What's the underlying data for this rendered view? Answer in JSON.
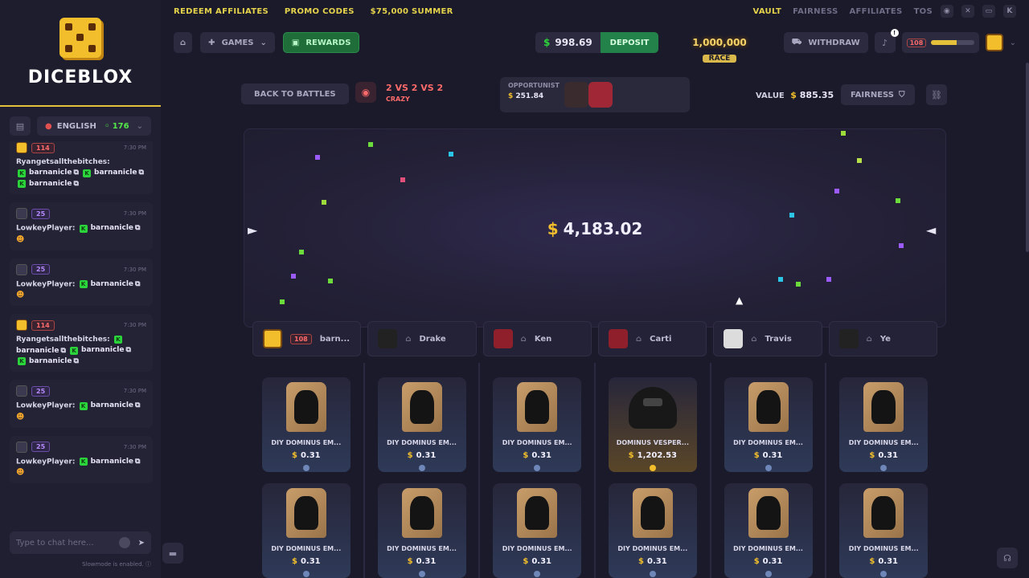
{
  "topbar": {
    "left_links": [
      "REDEEM AFFILIATES",
      "PROMO CODES",
      "$75,000 SUMMER"
    ],
    "right_links": [
      "VAULT",
      "FAIRNESS",
      "AFFILIATES",
      "TOS"
    ]
  },
  "brand": {
    "name": "DICEBLOX"
  },
  "sidebar": {
    "language": "ENGLISH",
    "online_count": "176",
    "chat_placeholder": "Type to chat here...",
    "slowmode_note": "Slowmode is enabled."
  },
  "chat": [
    {
      "user": "Ryangetsallthebitches:",
      "level": "114",
      "time": "7:30 PM",
      "mentions": [
        "barnanicle",
        "barnanicle",
        "barnanicle"
      ]
    },
    {
      "user": "LowkeyPlayer:",
      "level": "25",
      "time": "7:30 PM",
      "mentions": [
        "barnanicle"
      ]
    },
    {
      "user": "LowkeyPlayer:",
      "level": "25",
      "time": "7:30 PM",
      "mentions": [
        "barnanicle"
      ]
    },
    {
      "user": "Ryangetsallthebitches:",
      "level": "114",
      "time": "7:30 PM",
      "mentions": [
        "barnanicle",
        "barnanicle",
        "barnanicle"
      ]
    },
    {
      "user": "LowkeyPlayer:",
      "level": "25",
      "time": "7:30 PM",
      "mentions": [
        "barnanicle"
      ]
    },
    {
      "user": "LowkeyPlayer:",
      "level": "25",
      "time": "7:30 PM",
      "mentions": [
        "barnanicle"
      ]
    }
  ],
  "header": {
    "games_label": "GAMES",
    "rewards_label": "REWARDS",
    "balance": "998.69",
    "deposit_label": "DEPOSIT",
    "race_amount": "1,000,000",
    "race_label": "RACE",
    "withdraw_label": "WITHDRAW",
    "notif_count": "!",
    "user_level": "108",
    "xp_fraction": 0.6
  },
  "battle": {
    "back_label": "BACK TO BATTLES",
    "mode": "2 VS 2 VS 2",
    "mode_sub": "CRAZY",
    "opponent_label": "OPPORTUNIST",
    "opponent_value": "251.84",
    "value_label": "VALUE",
    "value_amount": "885.35",
    "fairness_label": "FAIRNESS",
    "total": "4,183.02"
  },
  "players": [
    {
      "name": "barn...",
      "level": "108"
    },
    {
      "name": "Drake"
    },
    {
      "name": "Ken"
    },
    {
      "name": "Carti"
    },
    {
      "name": "Travis"
    },
    {
      "name": "Ye"
    }
  ],
  "items_row1": [
    {
      "name": "DIY DOMINUS EM...",
      "price": "0.31"
    },
    {
      "name": "DIY DOMINUS EM...",
      "price": "0.31"
    },
    {
      "name": "DIY DOMINUS EM...",
      "price": "0.31"
    },
    {
      "name": "DOMINUS VESPER...",
      "price": "1,202.53"
    },
    {
      "name": "DIY DOMINUS EM...",
      "price": "0.31"
    },
    {
      "name": "DIY DOMINUS EM...",
      "price": "0.31"
    }
  ],
  "items_row2": [
    {
      "name": "DIY DOMINUS EM...",
      "price": "0.31"
    },
    {
      "name": "DIY DOMINUS EM...",
      "price": "0.31"
    },
    {
      "name": "DIY DOMINUS EM...",
      "price": "0.31"
    },
    {
      "name": "DIY DOMINUS EM...",
      "price": "0.31"
    },
    {
      "name": "DIY DOMINUS EM...",
      "price": "0.31"
    },
    {
      "name": "DIY DOMINUS EM...",
      "price": "0.31"
    }
  ],
  "colors": {
    "accent": "#e5c03b",
    "green": "#23824a",
    "level_red": "#ff6a6a",
    "level_purple": "#b78bff"
  }
}
